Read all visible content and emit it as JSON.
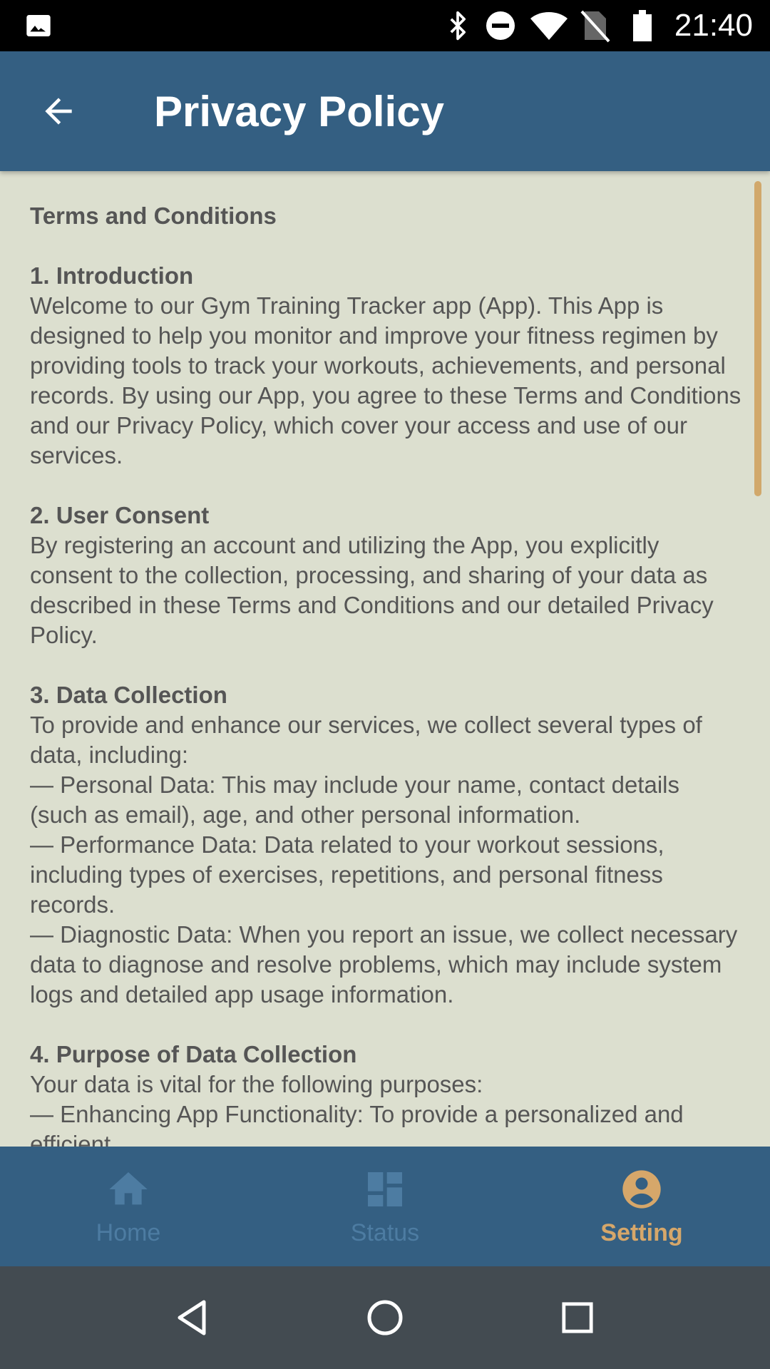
{
  "status_bar": {
    "time": "21:40",
    "icons": [
      "image-icon",
      "bluetooth-icon",
      "do-not-disturb-icon",
      "wifi-icon",
      "no-sim-icon",
      "battery-icon"
    ]
  },
  "app_bar": {
    "title": "Privacy Policy",
    "back_icon": "arrow-left-icon"
  },
  "document": {
    "heading": "Terms and Conditions",
    "sections": [
      {
        "title": "1. Introduction",
        "paragraphs": [
          "Welcome to our Gym Training Tracker app (App). This App is designed to help you monitor and improve your fitness regimen by providing tools to track your workouts, achievements, and personal records. By using our App, you agree to these Terms and Conditions and our Privacy Policy, which cover your access and use of our services."
        ]
      },
      {
        "title": "2. User Consent",
        "paragraphs": [
          "By registering an account and utilizing the App, you explicitly consent to the collection, processing, and sharing of your data as described in these Terms and Conditions and our detailed Privacy Policy."
        ]
      },
      {
        "title": "3. Data Collection",
        "paragraphs": [
          "To provide and enhance our services, we collect several types of data, including:",
          "— Personal Data: This may include your name, contact details (such as email), age, and other personal information.",
          "— Performance Data: Data related to your workout sessions, including types of exercises, repetitions, and personal fitness records.",
          "— Diagnostic Data: When you report an issue, we collect necessary data to diagnose and resolve problems, which may include system logs and detailed app usage information."
        ]
      },
      {
        "title": "4. Purpose of Data Collection",
        "paragraphs": [
          "Your data is vital for the following purposes:",
          "— Enhancing App Functionality: To provide a personalized and efficient"
        ]
      }
    ]
  },
  "bottom_nav": {
    "items": [
      {
        "label": "Home",
        "icon": "home-icon",
        "active": false
      },
      {
        "label": "Status",
        "icon": "dashboard-icon",
        "active": false
      },
      {
        "label": "Setting",
        "icon": "account-circle-icon",
        "active": true
      }
    ]
  },
  "colors": {
    "app_bar": "#345f82",
    "background": "#dcdfcf",
    "text": "#555555",
    "accent": "#d6a76a",
    "inactive_nav": "#4d7ca2"
  }
}
